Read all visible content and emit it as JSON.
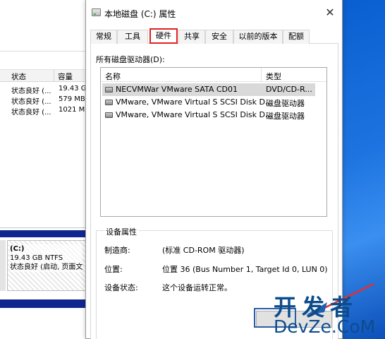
{
  "background_window": {
    "columns": [
      "状态",
      "容量"
    ],
    "rows": [
      {
        "status": "状态良好 (...",
        "capacity": "19.43 G"
      },
      {
        "status": "状态良好 (...",
        "capacity": "579 MB"
      },
      {
        "status": "状态良好 (...",
        "capacity": "1021 M"
      }
    ],
    "disk_box": {
      "label": "(C:)",
      "size": "19.43 GB NTFS",
      "status": "状态良好 (启动, 页面文"
    }
  },
  "dialog": {
    "title": "本地磁盘 (C:) 属性",
    "close_symbol": "✕",
    "tabs": [
      "常规",
      "工具",
      "硬件",
      "共享",
      "安全",
      "以前的版本",
      "配额"
    ],
    "active_tab": "硬件",
    "drives_label": "所有磁盘驱动器(D):",
    "list": {
      "col_name": "名称",
      "col_type": "类型",
      "rows": [
        {
          "name": "NECVMWar VMware SATA CD01",
          "type": "DVD/CD-R..."
        },
        {
          "name": "VMware, VMware Virtual S SCSI Disk D...",
          "type": "磁盘驱动器"
        },
        {
          "name": "VMware, VMware Virtual S SCSI Disk D...",
          "type": "磁盘驱动器"
        }
      ]
    },
    "properties": {
      "title": "设备属性",
      "manufacturer_label": "制造商:",
      "manufacturer_value": "(标准 CD-ROM 驱动器)",
      "location_label": "位置:",
      "location_value": "位置 36 (Bus Number 1, Target Id 0, LUN 0)",
      "status_label": "设备状态:",
      "status_value": "这个设备运转正常。"
    }
  },
  "watermark": {
    "cn": "开发者",
    "en": "DevZe.CoM"
  },
  "colors": {
    "active_tab_border": "#e02020",
    "disk_bar": "#10278f",
    "watermark": "#0c4c8c"
  }
}
